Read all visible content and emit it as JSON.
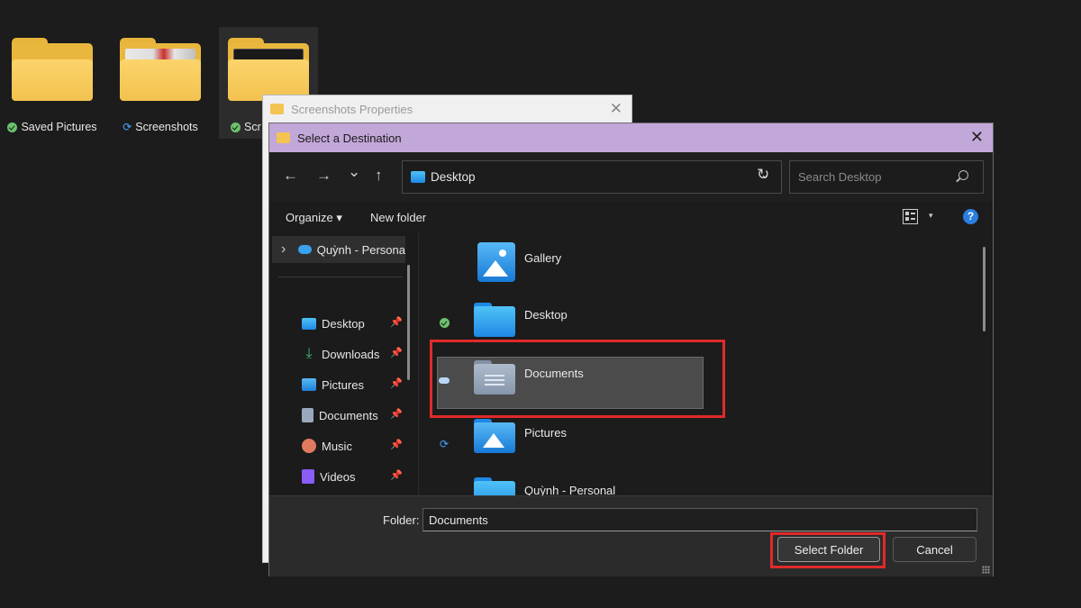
{
  "desktop": {
    "folders": [
      {
        "label": "Saved Pictures",
        "status": "synced"
      },
      {
        "label": "Screenshots",
        "status": "syncing"
      },
      {
        "label": "Scr",
        "status": "synced"
      }
    ]
  },
  "properties_window": {
    "title": "Screenshots Properties",
    "close": "✕"
  },
  "dialog": {
    "title": "Select a Destination",
    "close": "✕",
    "nav": {
      "back": "←",
      "forward": "→",
      "recent": "⌄",
      "up": "↑",
      "address": "Desktop",
      "address_dropdown": "⌄",
      "refresh": "↻",
      "search_placeholder": "Search Desktop"
    },
    "toolbar": {
      "organize": "Organize ▾",
      "new_folder": "New folder",
      "view_chevron": "▾",
      "help": "?"
    },
    "sidebar": {
      "top_item": "Quỳnh - Persona",
      "expand": "›",
      "items": [
        {
          "label": "Desktop",
          "icon": "desktop-icon",
          "pin": "📌"
        },
        {
          "label": "Downloads",
          "icon": "download-icon",
          "pin": "📌"
        },
        {
          "label": "Pictures",
          "icon": "pictures-icon",
          "pin": "📌"
        },
        {
          "label": "Documents",
          "icon": "documents-icon",
          "pin": "📌"
        },
        {
          "label": "Music",
          "icon": "music-icon",
          "pin": "📌"
        },
        {
          "label": "Videos",
          "icon": "videos-icon",
          "pin": "📌"
        }
      ]
    },
    "content": {
      "items": [
        {
          "name": "Gallery",
          "icon": "gallery-icon",
          "status": ""
        },
        {
          "name": "Desktop",
          "icon": "desktop-folder-icon",
          "status": "synced"
        },
        {
          "name": "Documents",
          "icon": "documents-folder-icon",
          "status": "cloud",
          "selected": true
        },
        {
          "name": "Pictures",
          "icon": "pictures-folder-icon",
          "status": "syncing"
        },
        {
          "name": "Quỳnh - Personal",
          "icon": "onedrive-folder-icon",
          "status": ""
        }
      ]
    },
    "footer": {
      "folder_label": "Folder:",
      "folder_value": "Documents",
      "select_button": "Select Folder",
      "cancel_button": "Cancel"
    }
  },
  "colors": {
    "title_bar": "#c2a7d9",
    "highlight": "#e02a2a",
    "folder_yellow": "#f2c24f",
    "folder_blue": "#2a9ae8",
    "accent_blue": "#2b7de0"
  }
}
